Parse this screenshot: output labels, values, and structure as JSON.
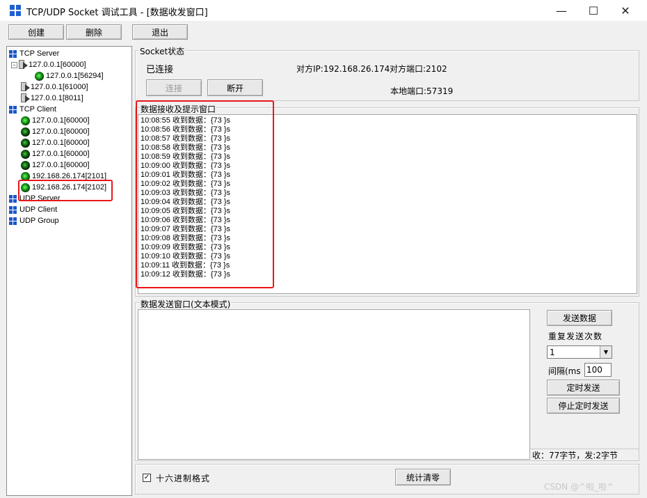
{
  "window": {
    "title": "TCP/UDP Socket 调试工具 - [数据收发窗口]",
    "controls": {
      "minimize": "—",
      "maximize": "☐",
      "close": "✕"
    }
  },
  "toolbar": {
    "create": "创建",
    "delete": "删除",
    "exit": "退出"
  },
  "tree": {
    "tcp_server": {
      "label": "TCP Server",
      "items": [
        {
          "label": "127.0.0.1[60000]",
          "expanded": true,
          "children": [
            {
              "label": "127.0.0.1[56294]"
            }
          ]
        },
        {
          "label": "127.0.0.1[61000]"
        },
        {
          "label": "127.0.0.1[8011]"
        }
      ]
    },
    "tcp_client": {
      "label": "TCP Client",
      "items": [
        {
          "label": "127.0.0.1[60000]"
        },
        {
          "label": "127.0.0.1[60000]"
        },
        {
          "label": "127.0.0.1[60000]"
        },
        {
          "label": "127.0.0.1[60000]"
        },
        {
          "label": "127.0.0.1[60000]"
        },
        {
          "label": "192.168.26.174[2101]"
        },
        {
          "label": "192.168.26.174[2102]",
          "selected": true
        }
      ]
    },
    "udp_server": {
      "label": "UDP Server"
    },
    "udp_client": {
      "label": "UDP Client"
    },
    "udp_group": {
      "label": "UDP Group"
    }
  },
  "socket_status": {
    "legend": "Socket状态",
    "state": "已连接",
    "peer_ip": "对方IP:192.168.26.174",
    "peer_port": "对方端口:2102",
    "local_port": "本地端口:57319",
    "connect": "连接",
    "disconnect": "断开"
  },
  "receive": {
    "legend": "数据接收及提示窗口",
    "lines": [
      "10:08:55 收到数据：{73 }s",
      "10:08:56 收到数据：{73 }s",
      "10:08:57 收到数据：{73 }s",
      "10:08:58 收到数据：{73 }s",
      "10:08:59 收到数据：{73 }s",
      "10:09:00 收到数据：{73 }s",
      "10:09:01 收到数据：{73 }s",
      "10:09:02 收到数据：{73 }s",
      "10:09:03 收到数据：{73 }s",
      "10:09:04 收到数据：{73 }s",
      "10:09:05 收到数据：{73 }s",
      "10:09:06 收到数据：{73 }s",
      "10:09:07 收到数据：{73 }s",
      "10:09:08 收到数据：{73 }s",
      "10:09:09 收到数据：{73 }s",
      "10:09:10 收到数据：{73 }s",
      "10:09:11 收到数据：{73 }s",
      "10:09:12 收到数据：{73 }s"
    ]
  },
  "send": {
    "legend": "数据发送窗口(文本模式)",
    "text": "",
    "send_button": "发送数据",
    "repeat_label": "重复发送次数",
    "repeat_value": "1",
    "interval_label": "间隔(ms",
    "interval_value": "100",
    "timed_send": "定时发送",
    "stop_timed_send": "停止定时发送",
    "stats": "收：77字节，发:2字节"
  },
  "bottom": {
    "hex_label": "十六进制格式",
    "hex_checked": true,
    "reset_stats": "统计清零"
  },
  "watermark": "CSDN @^啦_啦^",
  "colors": {
    "highlight_box": "#e8161a",
    "tree_icon": "#1a56c9",
    "connected": "#18a818"
  }
}
